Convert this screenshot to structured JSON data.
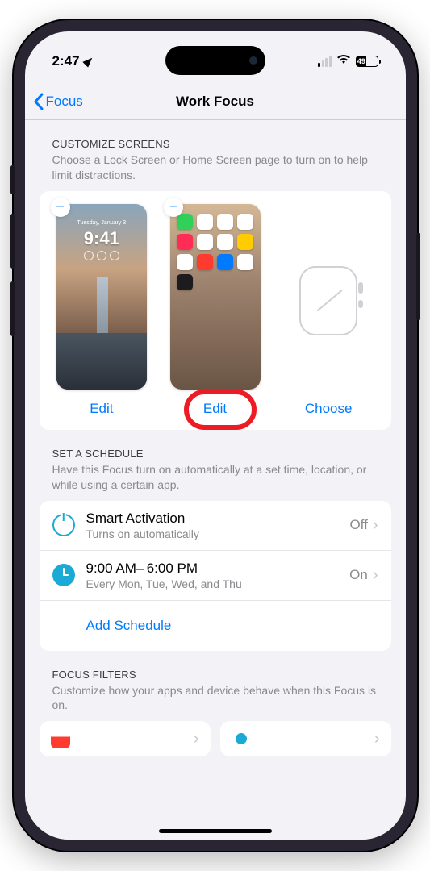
{
  "status_bar": {
    "time": "2:47",
    "battery": "49"
  },
  "nav": {
    "back_label": "Focus",
    "title": "Work Focus"
  },
  "customize": {
    "header": "Customize Screens",
    "sub": "Choose a Lock Screen or Home Screen page to turn on to help limit distractions.",
    "lock_time": "9:41",
    "lock_date": "Tuesday, January 3",
    "edit1": "Edit",
    "edit2": "Edit",
    "choose": "Choose"
  },
  "schedule": {
    "header": "Set a Schedule",
    "sub": "Have this Focus turn on automatically at a set time, location, or while using a certain app.",
    "smart_title": "Smart Activation",
    "smart_sub": "Turns on automatically",
    "smart_val": "Off",
    "time_title": "9:00 AM– 6:00 PM",
    "time_sub": "Every Mon, Tue, Wed, and Thu",
    "time_val": "On",
    "add": "Add Schedule"
  },
  "filters": {
    "header": "Focus Filters",
    "sub": "Customize how your apps and device behave when this Focus is on."
  }
}
